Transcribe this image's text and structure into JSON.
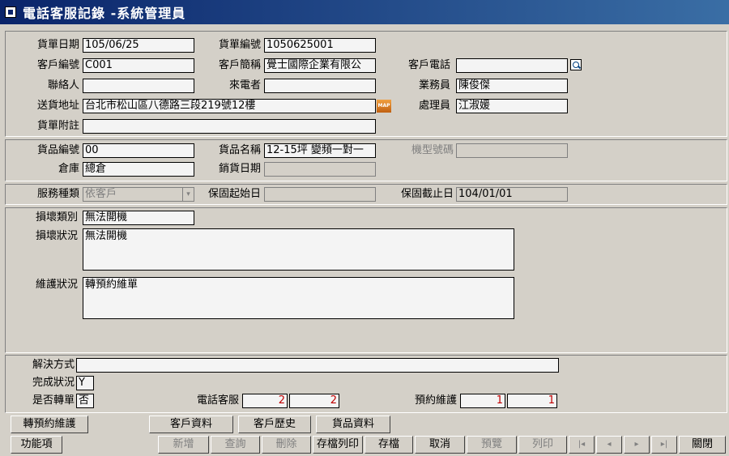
{
  "window": {
    "title": "電話客服記錄 -系統管理員"
  },
  "header": {
    "order_date_label": "貨單日期",
    "order_date": "105/06/25",
    "order_no_label": "貨單編號",
    "order_no": "1050625001",
    "cust_no_label": "客戶編號",
    "cust_no": "C001",
    "cust_short_label": "客戶簡稱",
    "cust_short": "覺士國際企業有限公",
    "cust_phone_label": "客戶電話",
    "cust_phone": "",
    "contact_label": "聯絡人",
    "contact": "",
    "caller_label": "來電者",
    "caller": "",
    "sales_label": "業務員",
    "sales": "陳俊傑",
    "address_label": "送貨地址",
    "address": "台北市松山區八德路三段219號12樓",
    "handler_label": "處理員",
    "handler": "江淑媛",
    "note_label": "貨單附註",
    "note": "",
    "map_label": "MAP"
  },
  "product": {
    "prod_no_label": "貨品編號",
    "prod_no": "00",
    "prod_name_label": "貨品名稱",
    "prod_name": "12-15坪 變頻一對一",
    "model_label": "機型號碼",
    "model": "",
    "warehouse_label": "倉庫",
    "warehouse": "總倉",
    "sale_date_label": "銷貨日期",
    "sale_date": ""
  },
  "service": {
    "type_label": "服務種類",
    "type_value": "依客戶",
    "warranty_start_label": "保固起始日",
    "warranty_start": "",
    "warranty_end_label": "保固截止日",
    "warranty_end": "104/01/01"
  },
  "damage": {
    "category_label": "損壞類別",
    "category": "無法開機",
    "status_label": "損壞狀況",
    "status": "無法開機",
    "maint_label": "維護狀況",
    "maint": "轉預約維單"
  },
  "result": {
    "solution_label": "解決方式",
    "solution": "",
    "complete_label": "完成狀況",
    "complete": "Y",
    "transfer_label": "是否轉單",
    "transfer": "否",
    "phone_service_label": "電話客服",
    "phone_count1": "2",
    "phone_count2": "2",
    "appt_label": "預約維護",
    "appt_count1": "1",
    "appt_count2": "1"
  },
  "buttons": {
    "to_appointment": "轉預約維護",
    "customer_info": "客戶資料",
    "customer_history": "客戶歷史",
    "product_info": "貨品資料",
    "functions": "功能項",
    "add": "新增",
    "query": "查詢",
    "delete": "刪除",
    "save_print": "存檔列印",
    "save": "存檔",
    "cancel": "取消",
    "preview": "預覽",
    "print": "列印",
    "first": "|◂",
    "prev": "◂",
    "next": "▸",
    "last": "▸|",
    "close": "關閉"
  }
}
